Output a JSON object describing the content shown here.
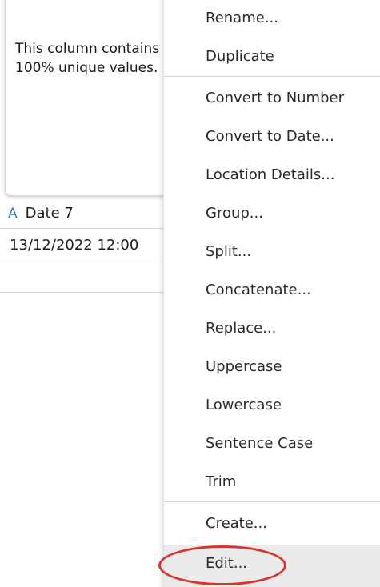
{
  "column_panel": {
    "info_text": "This column contains\n 100% unique values.",
    "header": {
      "type_icon": "A",
      "name": "Date 7"
    },
    "cell_value": "13/12/2022 12:00"
  },
  "context_menu": {
    "items": [
      {
        "label": "Rename..."
      },
      {
        "label": "Duplicate"
      },
      {
        "label": "Convert to Number"
      },
      {
        "label": "Convert to Date..."
      },
      {
        "label": "Location Details..."
      },
      {
        "label": "Group..."
      },
      {
        "label": "Split..."
      },
      {
        "label": "Concatenate..."
      },
      {
        "label": "Replace..."
      },
      {
        "label": "Uppercase"
      },
      {
        "label": "Lowercase"
      },
      {
        "label": "Sentence Case"
      },
      {
        "label": "Trim"
      },
      {
        "label": "Create..."
      },
      {
        "label": "Edit..."
      }
    ]
  },
  "colors": {
    "accent": "#3a7bd5",
    "annotation": "#d9342b",
    "highlight": "#ebebeb"
  }
}
